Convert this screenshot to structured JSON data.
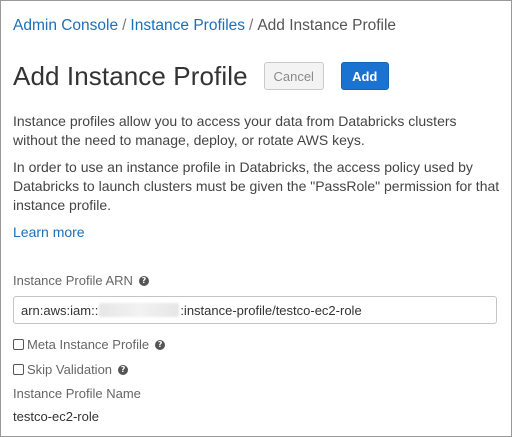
{
  "breadcrumb": {
    "items": [
      "Admin Console",
      "Instance Profiles",
      "Add Instance Profile"
    ],
    "separator": "/"
  },
  "header": {
    "title": "Add Instance Profile",
    "cancel_label": "Cancel",
    "add_label": "Add"
  },
  "description": {
    "paragraph1": "Instance profiles allow you to access your data from Databricks clusters without the need to manage, deploy, or rotate AWS keys.",
    "paragraph2": "In order to use an instance profile in Databricks, the access policy used by Databricks to launch clusters must be given the \"PassRole\" permission for that instance profile.",
    "learn_more": "Learn more"
  },
  "form": {
    "arn_label": "Instance Profile ARN",
    "arn_prefix": "arn:aws:iam::",
    "arn_suffix": ":instance-profile/testco-ec2-role",
    "meta_label": "Meta Instance Profile",
    "skip_label": "Skip Validation",
    "name_label": "Instance Profile Name",
    "name_value": "testco-ec2-role",
    "help_glyph": "?"
  },
  "icons": {
    "help": "help-circle-icon",
    "checkbox": "checkbox-unchecked"
  },
  "colors": {
    "link": "#1d6fb8",
    "primary_button": "#1a73d0",
    "text": "#333333"
  }
}
